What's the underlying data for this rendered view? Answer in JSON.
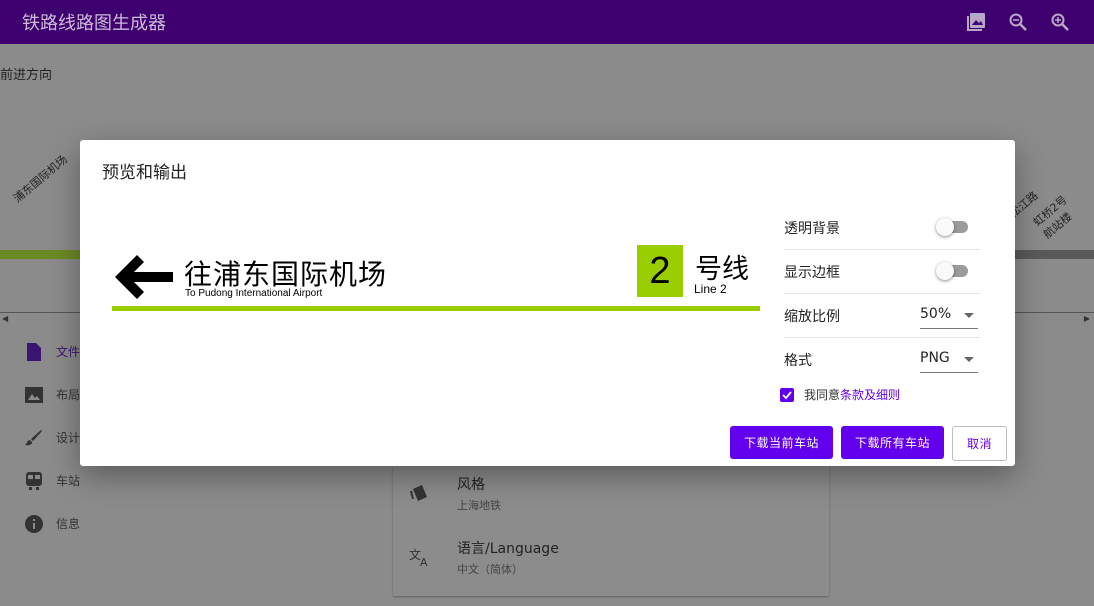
{
  "app": {
    "title": "铁路线路图生成器",
    "actions": [
      "template-icon",
      "zoom-out-icon",
      "zoom-in-icon"
    ]
  },
  "background": {
    "direction_label": "前进方向",
    "nav": [
      {
        "label": "文件",
        "icon": "file-icon"
      },
      {
        "label": "布局",
        "icon": "image-icon"
      },
      {
        "label": "设计",
        "icon": "brush-icon"
      },
      {
        "label": "车站",
        "icon": "train-icon"
      },
      {
        "label": "信息",
        "icon": "info-icon"
      }
    ],
    "settings": [
      {
        "title": "风格",
        "subtitle": "上海地铁",
        "icon": "style-icon"
      },
      {
        "title": "语言/Language",
        "subtitle": "中文（简体）",
        "icon": "translate-icon"
      }
    ],
    "stations_left": [
      "浦东国际机场"
    ],
    "stations_right": [
      "松江路",
      "虹桥2号航站楼"
    ]
  },
  "dialog": {
    "title": "预览和输出",
    "preview": {
      "destination_zh": "往浦东国际机场",
      "destination_en": "To Pudong International Airport",
      "line_number": "2",
      "line_zh": "号线",
      "line_en": "Line 2",
      "line_color": "#9acd00"
    },
    "options": {
      "transparent_bg": {
        "label": "透明背景",
        "checked": false
      },
      "show_border": {
        "label": "显示边框",
        "checked": false
      },
      "scale": {
        "label": "缩放比例",
        "value": "50%"
      },
      "format": {
        "label": "格式",
        "value": "PNG"
      }
    },
    "agree": {
      "checked": true,
      "text": "我同意",
      "link": "条款及细则"
    },
    "buttons": {
      "download_current": "下载当前车站",
      "download_all": "下载所有车站",
      "cancel": "取消"
    }
  },
  "colors": {
    "app_bar": "#3f006f",
    "primary": "#6200ee",
    "line_accent": "#9acd00"
  }
}
